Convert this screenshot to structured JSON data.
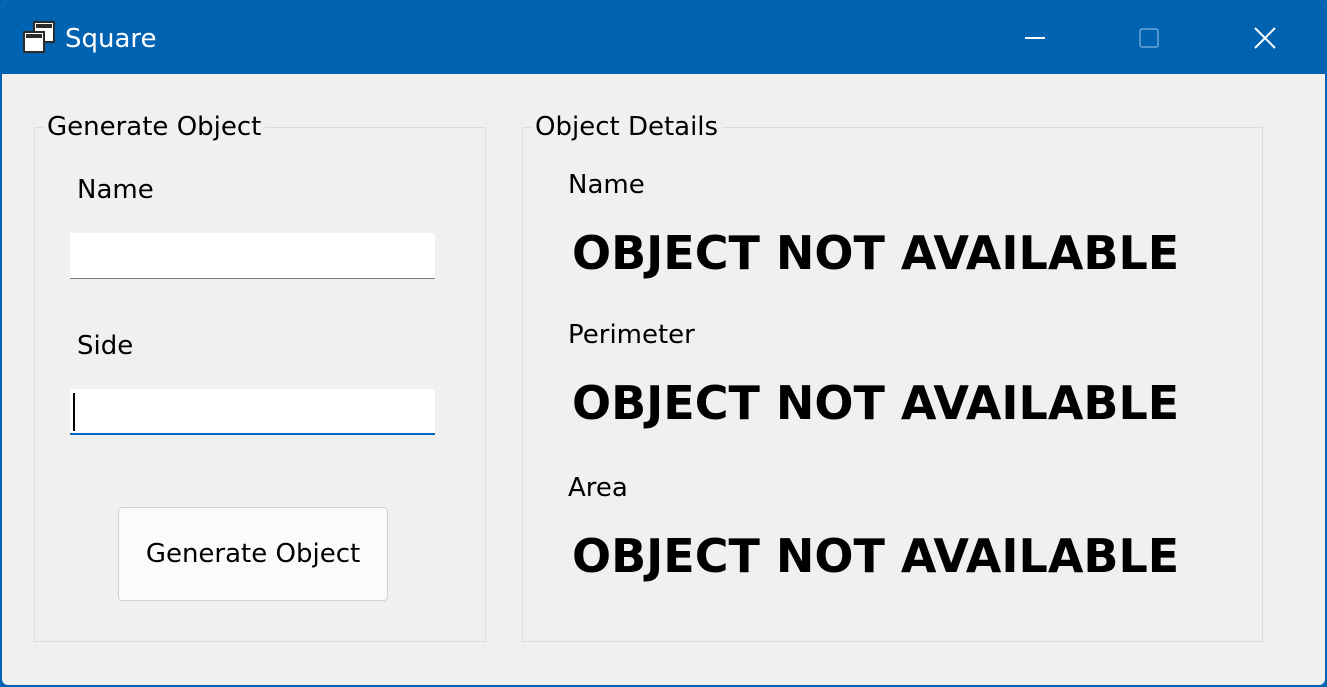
{
  "window": {
    "title": "Square"
  },
  "generate_group": {
    "legend": "Generate Object",
    "name_label": "Name",
    "name_value": "",
    "side_label": "Side",
    "side_value": "",
    "button_label": "Generate Object"
  },
  "details_group": {
    "legend": "Object Details",
    "name_label": "Name",
    "name_value": "OBJECT NOT AVAILABLE",
    "perimeter_label": "Perimeter",
    "perimeter_value": "OBJECT NOT AVAILABLE",
    "area_label": "Area",
    "area_value": "OBJECT NOT AVAILABLE"
  },
  "colors": {
    "titlebar": "#0063b1",
    "window_bg": "#f0f0f0",
    "focus_accent": "#0067c0"
  },
  "icons": {
    "app": "app-windows-icon",
    "minimize": "minimize-icon",
    "maximize": "maximize-icon",
    "close": "close-icon"
  }
}
